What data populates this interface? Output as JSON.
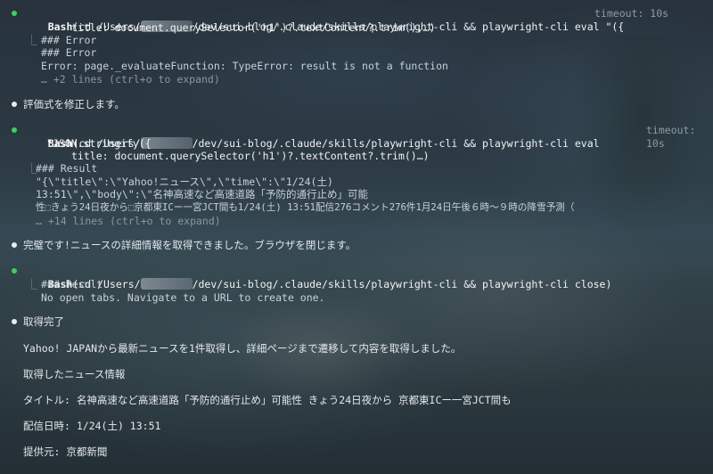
{
  "blocks": {
    "b1": {
      "tool": "Bash",
      "cmd_pre": "(cd /Users/",
      "cmd_post": "/dev/sui-blog/.claude/skills/playwright-cli && playwright-cli eval \"({",
      "timeout": "timeout: 10s",
      "line2": "title: document.querySelector('h1')?.textContent?.trim(),…)",
      "res1": "### Error",
      "res2": "### Error",
      "res3": "Error: page._evaluateFunction: TypeError: result is not a function",
      "expand": "… +2 lines (ctrl+o to expand)"
    },
    "msg1": "評価式を修正します。",
    "b2": {
      "tool": "Bash",
      "cmd_pre": "(cd /Users/",
      "cmd_post": "/dev/sui-blog/.claude/skills/playwright-cli && playwright-cli eval",
      "timeout1": "timeout:",
      "timeout2": "10s",
      "line2": "\"JSON.stringify({",
      "line3": "title: document.querySelector('h1')?.textContent?.trim()…)",
      "res1": "### Result",
      "res2": "\"{\\\"title\\\":\\\"Yahoo!ニュース\\\",\\\"time\\\":\\\"1/24(土)",
      "res3": "13:51\\\",\\\"body\\\":\\\"名神高速など高速道路「予防的通行止め」可能",
      "res4": "性⬚きょう24日夜から⬚京都東ICー一宮JCT間も1/24(土) 13:51配信276コメント276件1月24日午後６時～９時の降雪予測（",
      "expand": "… +14 lines (ctrl+o to expand)"
    },
    "msg2": "完璧です!ニュースの詳細情報を取得できました。ブラウザを閉じます。",
    "b3": {
      "tool": "Bash",
      "cmd_pre": "(cd /Users/",
      "cmd_post": "/dev/sui-blog/.claude/skills/playwright-cli && playwright-cli close)",
      "res1": "### Result",
      "res2": "No open tabs. Navigate to a URL to create one."
    },
    "msg3": "取得完了",
    "p1": "Yahoo! JAPANから最新ニュースを1件取得し、詳細ページまで遷移して内容を取得しました。",
    "p2": "取得したニュース情報",
    "p3": "タイトル: 名神高速など高速道路「予防的通行止め」可能性 きょう24日夜から 京都東ICー一宮JCT間も",
    "p4": "配信日時: 1/24(土) 13:51",
    "p5": "提供元: 京都新聞"
  },
  "colors": {
    "bullet_green": "#3fcf5e",
    "bullet_white": "#e8ecef"
  }
}
